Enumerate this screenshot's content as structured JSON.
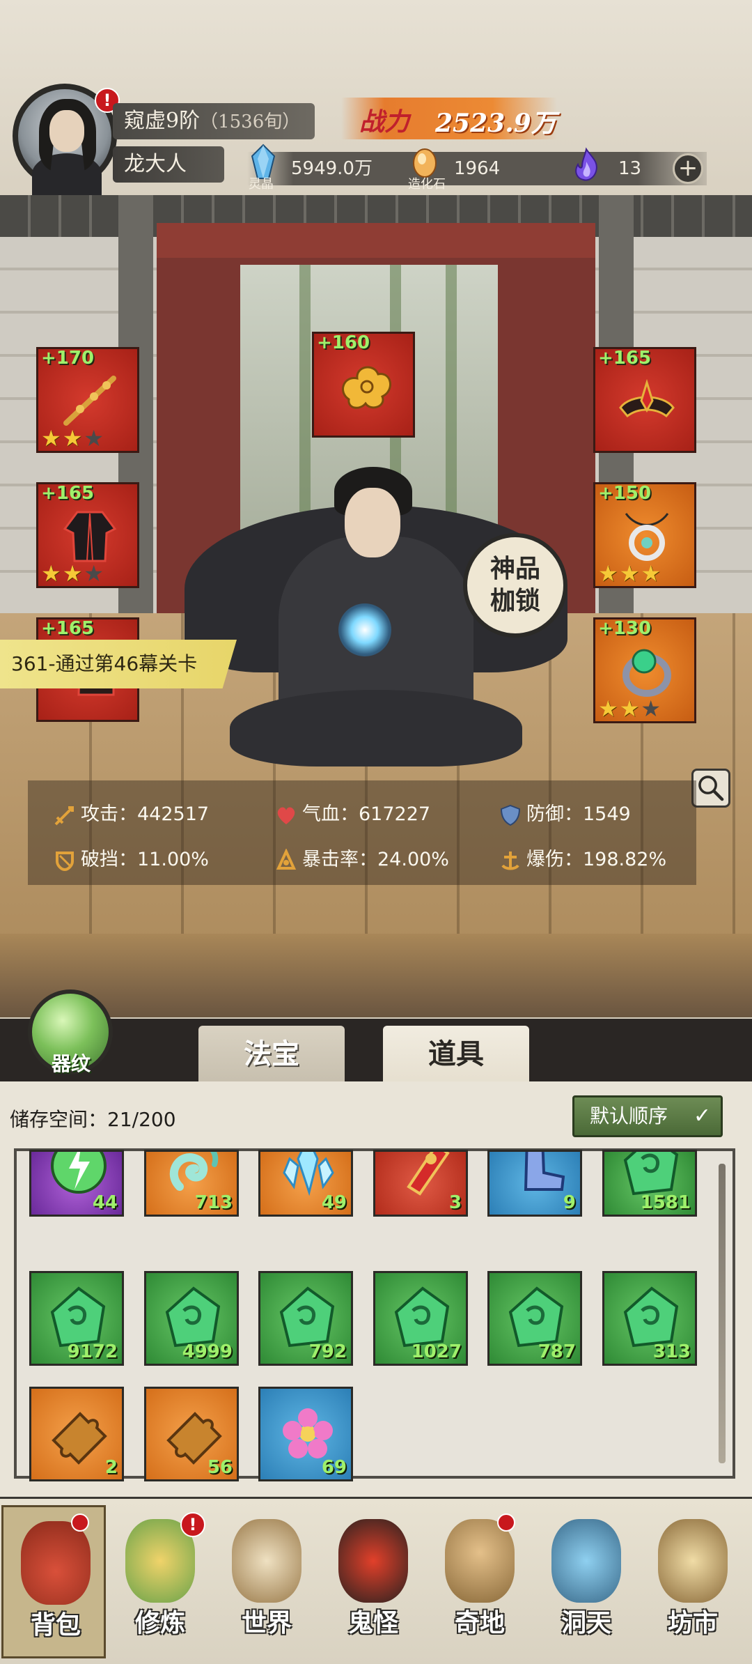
{
  "header": {
    "realm": "窥虚9阶",
    "realm_sub": "（1536旬）",
    "username": "龙大人",
    "power_label": "战力",
    "power_value": "2523.9万",
    "resources": [
      {
        "icon": "spirit-crystal-icon",
        "caption": "灵晶",
        "value": "5949.0万"
      },
      {
        "icon": "creation-stone-icon",
        "caption": "造化石",
        "value": "1964"
      },
      {
        "icon": "purple-flame-icon",
        "caption": "",
        "value": "13"
      }
    ],
    "alert": "!"
  },
  "equipment": {
    "left": [
      {
        "level": "+170",
        "stars": 2,
        "max": 3,
        "color": "red",
        "icon": "chain-whip-icon"
      },
      {
        "level": "+165",
        "stars": 2,
        "max": 3,
        "color": "red",
        "icon": "robe-icon"
      },
      {
        "level": "+165",
        "stars": 0,
        "max": 3,
        "color": "red",
        "icon": "boots-icon"
      }
    ],
    "center": {
      "level": "+160",
      "color": "red",
      "icon": "golden-cloud-icon"
    },
    "right": [
      {
        "level": "+165",
        "stars": 0,
        "max": 0,
        "color": "red",
        "icon": "crown-icon"
      },
      {
        "level": "+150",
        "stars": 3,
        "max": 3,
        "color": "orange",
        "icon": "amulet-icon"
      },
      {
        "level": "+130",
        "stars": 2,
        "max": 3,
        "color": "orange",
        "icon": "jade-ring-icon"
      }
    ]
  },
  "quest_banner": "361-通过第46幕关卡",
  "seal": {
    "line1": "神品",
    "line2": "枷锁"
  },
  "stats": [
    {
      "icon": "sword-icon",
      "label": "攻击：",
      "value": "442517",
      "color": "#e2a23a"
    },
    {
      "icon": "heart-icon",
      "label": "气血：",
      "value": "617227",
      "color": "#e04848"
    },
    {
      "icon": "shield-icon",
      "label": "防御：",
      "value": "1549",
      "color": "#6a8fc6"
    },
    {
      "icon": "break-guard-icon",
      "label": "破挡：",
      "value": "11.00%",
      "color": "#e2a23a"
    },
    {
      "icon": "crit-icon",
      "label": "暴击率：",
      "value": "24.00%",
      "color": "#e2a23a"
    },
    {
      "icon": "crit-damage-icon",
      "label": "爆伤：",
      "value": "198.82%",
      "color": "#e2a23a"
    }
  ],
  "orb_label": "器纹",
  "tabs": [
    {
      "label": "法宝",
      "active": false
    },
    {
      "label": "道具",
      "active": true
    }
  ],
  "inventory": {
    "storage_label": "储存空间：",
    "storage_value": "21/200",
    "sort_label": "默认顺序",
    "items": [
      {
        "color": "purple",
        "icon": "lightning-orb-icon",
        "qty": "44"
      },
      {
        "color": "orange",
        "icon": "cyan-swirl-icon",
        "qty": "713"
      },
      {
        "color": "orange",
        "icon": "ice-crystal-icon",
        "qty": "49"
      },
      {
        "color": "red",
        "icon": "red-talisman-icon",
        "qty": "3"
      },
      {
        "color": "blue",
        "icon": "blue-boot-icon",
        "qty": "9"
      },
      {
        "color": "green",
        "icon": "jade-shard-icon",
        "qty": "1581"
      },
      {
        "color": "green",
        "icon": "jade-shard-icon",
        "qty": "9172"
      },
      {
        "color": "green",
        "icon": "jade-shard-icon",
        "qty": "4999"
      },
      {
        "color": "green",
        "icon": "jade-shard-icon",
        "qty": "792"
      },
      {
        "color": "green",
        "icon": "jade-shard-icon",
        "qty": "1027"
      },
      {
        "color": "green",
        "icon": "jade-shard-icon",
        "qty": "787"
      },
      {
        "color": "green",
        "icon": "jade-shard-icon",
        "qty": "313"
      },
      {
        "color": "orange",
        "icon": "puzzle-fragment-icon",
        "qty": "2"
      },
      {
        "color": "orange",
        "icon": "puzzle-fragment-icon",
        "qty": "56"
      },
      {
        "color": "blue",
        "icon": "pink-flower-icon",
        "qty": "69"
      }
    ]
  },
  "nav": [
    {
      "label": "背包",
      "icon": "bag-icon",
      "active": true,
      "badge": false
    },
    {
      "label": "修炼",
      "icon": "lotus-icon",
      "active": false,
      "badge": true
    },
    {
      "label": "世界",
      "icon": "scroll-map-icon",
      "active": false,
      "badge": false
    },
    {
      "label": "鬼怪",
      "icon": "demon-egg-icon",
      "active": false,
      "badge": false
    },
    {
      "label": "奇地",
      "icon": "floating-island-icon",
      "active": false,
      "badge": false
    },
    {
      "label": "洞天",
      "icon": "portal-icon",
      "active": false,
      "badge": false
    },
    {
      "label": "坊市",
      "icon": "market-stall-icon",
      "active": false,
      "badge": false
    }
  ]
}
